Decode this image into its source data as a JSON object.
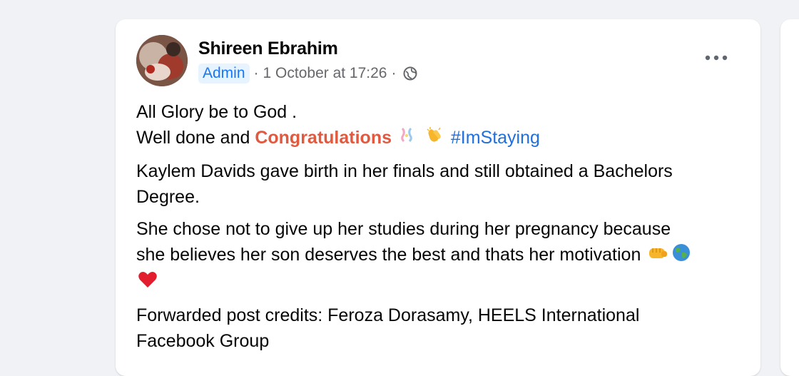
{
  "post": {
    "author_name": "Shireen Ebrahim",
    "role_badge": "Admin",
    "separator": "·",
    "timestamp": "1 October at 17:26",
    "privacy_icon": "globe-icon",
    "more_icon": "more-options-icon",
    "lines": {
      "line1": "All Glory be to God .",
      "line2_prefix": "Well done and ",
      "line2_highlight": "Congratulations",
      "line2_hashtag": "#ImStaying",
      "para2_line1": "Kaylem Davids gave birth in her finals and still obtained a Bachelors",
      "para2_line2": "Degree.",
      "para3_line1": "She chose not to give up her studies during her pregnancy because",
      "para3_line2": "she believes her son deserves the best and thats her motivation",
      "para4_line1": "Forwarded post credits: Feroza Dorasamy, HEELS International",
      "para4_line2": "Facebook Group"
    },
    "emoji_icons": [
      "ribbon-icon",
      "clapping-hands-icon",
      "raised-fist-icon",
      "globe-earth-icon",
      "red-heart-icon"
    ]
  },
  "colors": {
    "page_background": "#f0f2f5",
    "badge_text": "#1877f2",
    "highlight": "#e1593f",
    "hashtag": "#216fdb"
  }
}
